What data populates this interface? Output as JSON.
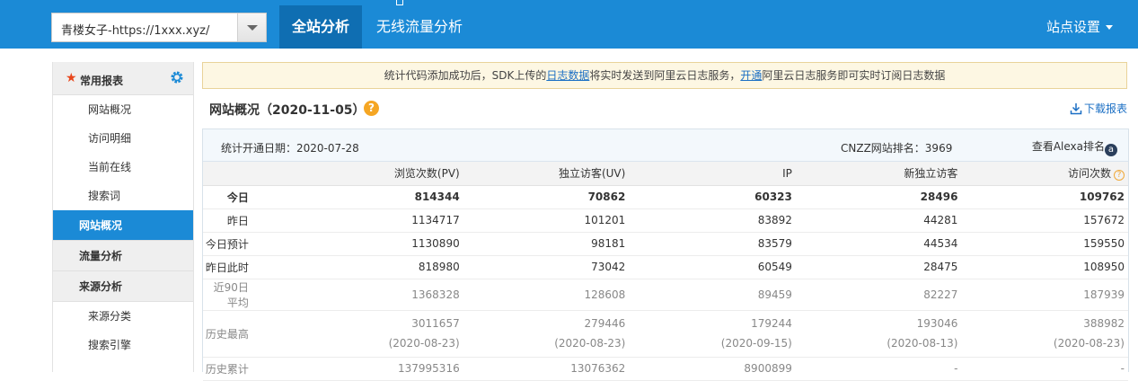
{
  "topbar": {
    "site_select_value": "青楼女子-https://1xxx.xyz/",
    "tabs": [
      {
        "label": "全站分析",
        "active": true
      },
      {
        "label": "无线流量分析",
        "active": false
      }
    ],
    "site_settings_label": "站点设置",
    "accent_color": "#1b8ad6"
  },
  "sidebar": {
    "header_title": "常用报表",
    "header_icon": "star-icon",
    "settings_icon": "gear-icon",
    "items": [
      {
        "label": "网站概况",
        "type": "item"
      },
      {
        "label": "访问明细",
        "type": "item"
      },
      {
        "label": "当前在线",
        "type": "item"
      },
      {
        "label": "搜索词",
        "type": "item"
      },
      {
        "label": "网站概况",
        "type": "group",
        "active": true
      },
      {
        "label": "流量分析",
        "type": "group"
      },
      {
        "label": "来源分析",
        "type": "group"
      },
      {
        "label": "来源分类",
        "type": "item"
      },
      {
        "label": "搜索引擎",
        "type": "item"
      }
    ]
  },
  "notice": {
    "part1": "统计代码添加成功后，SDK上传的",
    "link1": "日志数据",
    "part2": "将实时发送到阿里云日志服务，",
    "link2": "开通",
    "part3": "阿里云日志服务即可实时订阅日志数据"
  },
  "main": {
    "title": "网站概况（2020-11-05）",
    "help_icon": "question-icon",
    "download_label": "下载报表",
    "start_date": "统计开通日期：2020-07-28",
    "rank": "CNZZ网站排名：3969",
    "alexa_label": "查看Alexa排名"
  },
  "table": {
    "headers": [
      "",
      "浏览次数(PV)",
      "独立访客(UV)",
      "IP",
      "新独立访客",
      "访问次数"
    ],
    "rows": [
      {
        "label": "今日",
        "values": [
          "814344",
          "70862",
          "60323",
          "28496",
          "109762"
        ]
      },
      {
        "label": "昨日",
        "values": [
          "1134717",
          "101201",
          "83892",
          "44281",
          "157672"
        ]
      },
      {
        "label": "今日预计",
        "values": [
          "1130890",
          "98181",
          "83579",
          "44534",
          "159550"
        ]
      },
      {
        "label": "昨日此时",
        "values": [
          "818980",
          "73042",
          "60549",
          "28475",
          "108950"
        ]
      },
      {
        "label": "近90日平均",
        "values": [
          "1368328",
          "128608",
          "89459",
          "82227",
          "187939"
        ]
      },
      {
        "label": "历史最高",
        "values": [
          "3011657",
          "279446",
          "179244",
          "193046",
          "388982"
        ],
        "dates": [
          "(2020-08-23)",
          "(2020-08-23)",
          "(2020-09-15)",
          "(2020-08-13)",
          "(2020-08-23)"
        ]
      },
      {
        "label": "历史累计",
        "values": [
          "137995316",
          "13076362",
          "8900899",
          "-",
          "-"
        ]
      }
    ]
  }
}
